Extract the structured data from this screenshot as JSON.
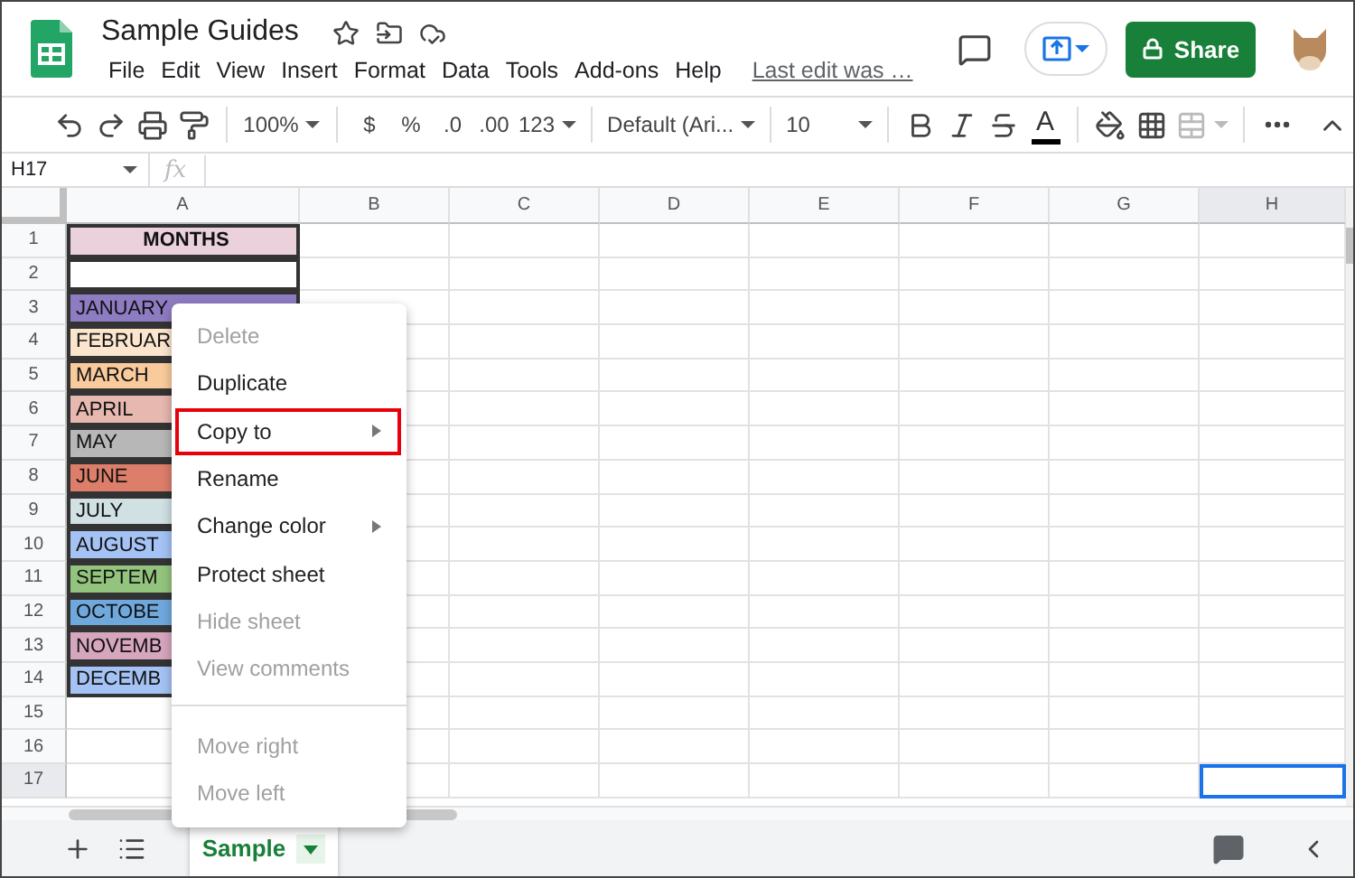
{
  "app": {
    "title": "Sample Guides",
    "menu": [
      "File",
      "Edit",
      "View",
      "Insert",
      "Format",
      "Data",
      "Tools",
      "Add-ons",
      "Help"
    ],
    "last_edit": "Last edit was …",
    "share": "Share"
  },
  "toolbar": {
    "zoom": "100%",
    "currency": "$",
    "percent": "%",
    "decimal_less": ".0",
    "decimal_more": ".00",
    "number_format": "123",
    "font": "Default (Ari...",
    "font_size": "10",
    "text_color": "A"
  },
  "formula_bar": {
    "cell_ref": "H17",
    "fx": "fx"
  },
  "columns": [
    {
      "label": "A",
      "selected": false
    },
    {
      "label": "B",
      "selected": false
    },
    {
      "label": "C",
      "selected": false
    },
    {
      "label": "D",
      "selected": false
    },
    {
      "label": "E",
      "selected": false
    },
    {
      "label": "F",
      "selected": false
    },
    {
      "label": "G",
      "selected": false
    },
    {
      "label": "H",
      "selected": true
    }
  ],
  "rows": [
    {
      "number": "1",
      "selected": false,
      "cell": {
        "kind": "header",
        "text": "MONTHS",
        "color": "#ead1dc"
      }
    },
    {
      "number": "2",
      "selected": false,
      "cell": {
        "kind": "month",
        "color": "#ffffff"
      }
    },
    {
      "number": "3",
      "selected": false,
      "cell": {
        "kind": "month",
        "text": "JANUARY",
        "color": "#8e7cc3"
      }
    },
    {
      "number": "4",
      "selected": false,
      "cell": {
        "kind": "month",
        "text": "FEBRUAR",
        "color": "#fce5cd"
      }
    },
    {
      "number": "5",
      "selected": false,
      "cell": {
        "kind": "month",
        "text": "MARCH",
        "color": "#f9cb9c"
      }
    },
    {
      "number": "6",
      "selected": false,
      "cell": {
        "kind": "month",
        "text": "APRIL",
        "color": "#e6b8af"
      }
    },
    {
      "number": "7",
      "selected": false,
      "cell": {
        "kind": "month",
        "text": "MAY",
        "color": "#b7b7b7"
      }
    },
    {
      "number": "8",
      "selected": false,
      "cell": {
        "kind": "month",
        "text": "JUNE",
        "color": "#dd7e6b"
      }
    },
    {
      "number": "9",
      "selected": false,
      "cell": {
        "kind": "month",
        "text": "JULY",
        "color": "#d0e0e3"
      }
    },
    {
      "number": "10",
      "selected": false,
      "cell": {
        "kind": "month",
        "text": "AUGUST",
        "color": "#a4c2f4"
      }
    },
    {
      "number": "11",
      "selected": false,
      "cell": {
        "kind": "month",
        "text": "SEPTEM",
        "color": "#93c47d"
      }
    },
    {
      "number": "12",
      "selected": false,
      "cell": {
        "kind": "month",
        "text": "OCTOBE",
        "color": "#6fa8dc"
      }
    },
    {
      "number": "13",
      "selected": false,
      "cell": {
        "kind": "month",
        "text": "NOVEMB",
        "color": "#d5a6bd"
      }
    },
    {
      "number": "14",
      "selected": false,
      "cell": {
        "kind": "month",
        "text": "DECEMB",
        "color": "#a4c2f4"
      }
    },
    {
      "number": "15",
      "selected": false
    },
    {
      "number": "16",
      "selected": false
    },
    {
      "number": "17",
      "selected": true
    }
  ],
  "context_menu": [
    {
      "kind": "item",
      "label": "Delete",
      "disabled": true,
      "submenu": false,
      "highlighted": false
    },
    {
      "kind": "item",
      "label": "Duplicate",
      "disabled": false,
      "submenu": false,
      "highlighted": false
    },
    {
      "kind": "item",
      "label": "Copy to",
      "disabled": false,
      "submenu": true,
      "highlighted": true
    },
    {
      "kind": "item",
      "label": "Rename",
      "disabled": false,
      "submenu": false,
      "highlighted": false
    },
    {
      "kind": "item",
      "label": "Change color",
      "disabled": false,
      "submenu": true,
      "highlighted": false
    },
    {
      "kind": "item",
      "label": "Protect sheet",
      "disabled": false,
      "submenu": false,
      "highlighted": false
    },
    {
      "kind": "item",
      "label": "Hide sheet",
      "disabled": true,
      "submenu": false,
      "highlighted": false
    },
    {
      "kind": "item",
      "label": "View comments",
      "disabled": true,
      "submenu": false,
      "highlighted": false
    },
    {
      "kind": "divider"
    },
    {
      "kind": "item",
      "label": "Move right",
      "disabled": true,
      "submenu": false,
      "highlighted": false
    },
    {
      "kind": "item",
      "label": "Move left",
      "disabled": true,
      "submenu": false,
      "highlighted": false
    }
  ],
  "sheet_tabs": [
    {
      "label": "Sample",
      "selected": true
    }
  ]
}
